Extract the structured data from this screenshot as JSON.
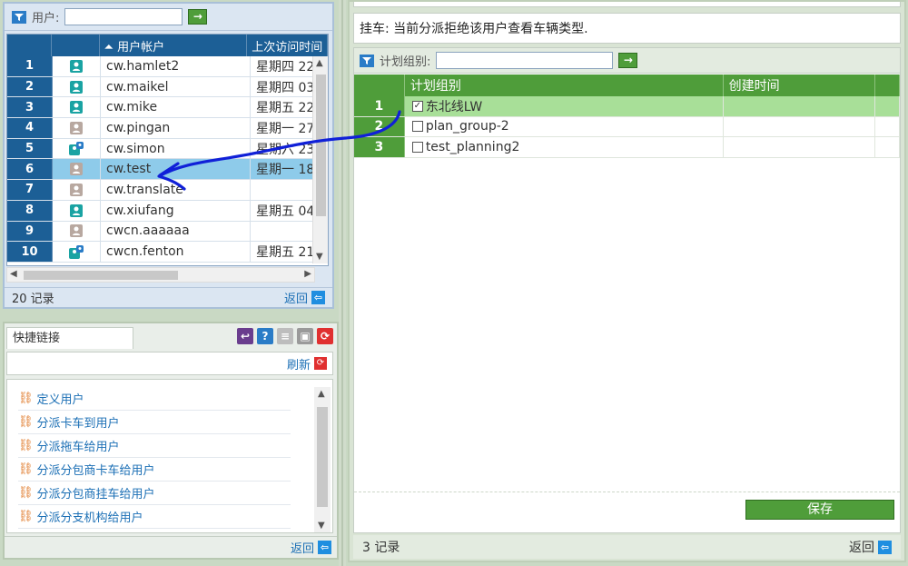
{
  "users_panel": {
    "filter_label": "用户:",
    "filter_value": "",
    "go_label": "→",
    "columns": [
      "",
      "",
      "⏶ 用户帐户",
      "上次访问时间"
    ],
    "rows": [
      {
        "num": "1",
        "icon": "user-green",
        "account": "cw.hamlet2",
        "last_visit": "星期四 22"
      },
      {
        "num": "2",
        "icon": "user-green",
        "account": "cw.maikel",
        "last_visit": "星期四 03"
      },
      {
        "num": "3",
        "icon": "user-green",
        "account": "cw.mike",
        "last_visit": "星期五 22"
      },
      {
        "num": "4",
        "icon": "user-gray",
        "account": "cw.pingan",
        "last_visit": "星期一 27"
      },
      {
        "num": "5",
        "icon": "user-group",
        "account": "cw.simon",
        "last_visit": "星期六 23"
      },
      {
        "num": "6",
        "icon": "user-gray",
        "account": "cw.test",
        "last_visit": "星期一 18"
      },
      {
        "num": "7",
        "icon": "user-gray",
        "account": "cw.translate",
        "last_visit": ""
      },
      {
        "num": "8",
        "icon": "user-green",
        "account": "cw.xiufang",
        "last_visit": "星期五 04"
      },
      {
        "num": "9",
        "icon": "user-gray",
        "account": "cwcn.aaaaaa",
        "last_visit": ""
      },
      {
        "num": "10",
        "icon": "user-group",
        "account": "cwcn.fenton",
        "last_visit": "星期五 21"
      }
    ],
    "selected_row": 5,
    "record_count": "20 记录",
    "back_label": "返回"
  },
  "links_panel": {
    "tab_label": "快捷链接",
    "refresh_label": "刷新",
    "items": [
      "定义用户",
      "分派卡车到用户",
      "分派拖车给用户",
      "分派分包商卡车给用户",
      "分派分包商挂车给用户",
      "分派分支机构给用户"
    ],
    "back_label": "返回"
  },
  "right_panel": {
    "message": "挂车: 当前分派拒绝该用户查看车辆类型.",
    "filter_label": "计划组别:",
    "filter_value": "",
    "go_label": "→",
    "columns": [
      "",
      "计划组别",
      "创建时间",
      ""
    ],
    "rows": [
      {
        "num": "1",
        "name": "东北线LW",
        "checked": true,
        "created": ""
      },
      {
        "num": "2",
        "name": "plan_group-2",
        "checked": false,
        "created": ""
      },
      {
        "num": "3",
        "name": "test_planning2",
        "checked": false,
        "created": ""
      }
    ],
    "selected_row": 0,
    "save_label": "保存",
    "record_count": "3 记录",
    "back_label": "返回"
  },
  "colors": {
    "grid_header_blue": "#1c5f96",
    "grid_header_green": "#4f9d3a",
    "selected_blue": "#8ecbea",
    "selected_green": "#a8df98",
    "annotation_stroke": "#1020d8"
  }
}
